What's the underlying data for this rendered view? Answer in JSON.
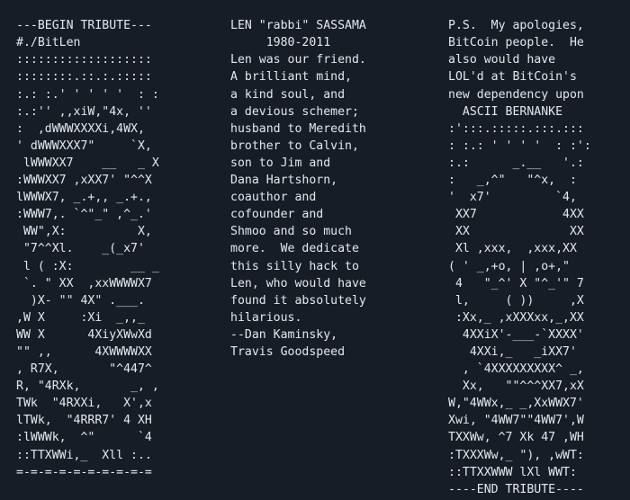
{
  "page": {
    "title": "BitLen ASCII Tribute",
    "background_color": "#161d27",
    "text_color": "#e4e8ef",
    "accent_teal": "#74b4c6",
    "accent_blue": "#6f7fc4",
    "font": "monospace",
    "columns": 3,
    "line_count": 29
  },
  "columns": {
    "left": {
      "name": "ascii-art-column",
      "header": "---BEGIN TRIBUTE---",
      "subheader": "#./BitLen",
      "footer": "=-=-=-=-=-=-=-=-=-=",
      "lines": [
        "---BEGIN TRIBUTE---",
        "#./BitLen",
        ":::::::::::::::::::",
        "::::::::.::.:.:::::",
        ":.: :.' ' ' ' '  : :",
        ":.:'' ,,xiW,\"4x, ''",
        ":  ,dWWWXXXXi,4WX,",
        "' dWWWXXX7\"     `X,",
        " lWWWXX7    __   _ X",
        ":WWWXX7 ,xXX7' \"^^X",
        "lWWWX7, _.+,, _.+.,",
        ":WWW7,. `^\"_\" ,^_.'",
        " WW\",X:          X,",
        " \"7^^Xl.    _(_x7'",
        " l ( :X:        __ _",
        " `. \" XX  ,xxWWWWX7",
        "  )X- \"\" 4X\" .___.",
        ",W X     :Xi  _,,_",
        "WW X      4XiyXWwXd",
        "\"\" ,,      4XWWWWXX",
        ", R7X,       \"^447^",
        "R, \"4RXk,       _, ,",
        "TWk  \"4RXXi,   X',x",
        "lTWk,  \"4RRR7' 4 XH",
        ":lWWWk,  ^\"      `4",
        "::TTXWWi,_  Xll :..",
        "=-=-=-=-=-=-=-=-=-="
      ]
    },
    "middle": {
      "name": "memorial-text-column",
      "person_name": "LEN \"rabbi\" SASSAMA",
      "dates": "1980-2011",
      "signature_1": "--Dan Kaminsky,",
      "signature_2": "Travis Goodspeed",
      "lines": [
        "LEN \"rabbi\" SASSAMA",
        "     1980-2011",
        "Len was our friend.",
        "A brilliant mind,",
        "a kind soul, and",
        "a devious schemer;",
        "husband to Meredith",
        "brother to Calvin,",
        "son to Jim and",
        "Dana Hartshorn,",
        "coauthor and",
        "cofounder and",
        "Shmoo and so much",
        "more.  We dedicate",
        "this silly hack to",
        "Len, who would have",
        "found it absolutely",
        "hilarious.",
        "--Dan Kaminsky,",
        "Travis Goodspeed"
      ]
    },
    "right": {
      "name": "postscript-bernanke-column",
      "postscript": "P.S.  My apologies, BitCoin people.  He also would have LOL'd at BitCoin's new dependency upon",
      "art_title": "ASCII BERNANKE",
      "footer": "----END TRIBUTE----",
      "lines": [
        "P.S.  My apologies,",
        "BitCoin people.  He",
        "also would have",
        "LOL'd at BitCoin's",
        "new dependency upon",
        "  ASCII BERNANKE",
        ":':::.:::::.:::.:::",
        ": :.: ' ' ' '  : :':",
        ":.:      _.__   '.:",
        ":   _,^\"   \"^x,  :",
        "'  x7'         `4,",
        " XX7            4XX",
        " XX              XX",
        " Xl ,xxx,  ,xxx,XX",
        "( ' _,+o, | ,o+,\"",
        " 4   \"_^' X \"^_'\" 7",
        " l,     ( ))     ,X",
        " :Xx,_ ,xXXXxx,_,XX",
        "  4XXiX'-___-`XXXX'",
        "   4XXi,_   _iXX7'",
        "  , `4XXXXXXXXX^ _,",
        "  Xx,   \"\"^^^XX7,xX",
        "W,\"4WWx,_ _,XxWWX7'",
        "Xwi, \"4WW7\"\"4WW7',W",
        "TXXWw, ^7 Xk 47 ,WH",
        ":TXXXWw,_ \"), ,wWT:",
        "::TTXXWWW lXl WWT:",
        "----END TRIBUTE----"
      ]
    }
  }
}
